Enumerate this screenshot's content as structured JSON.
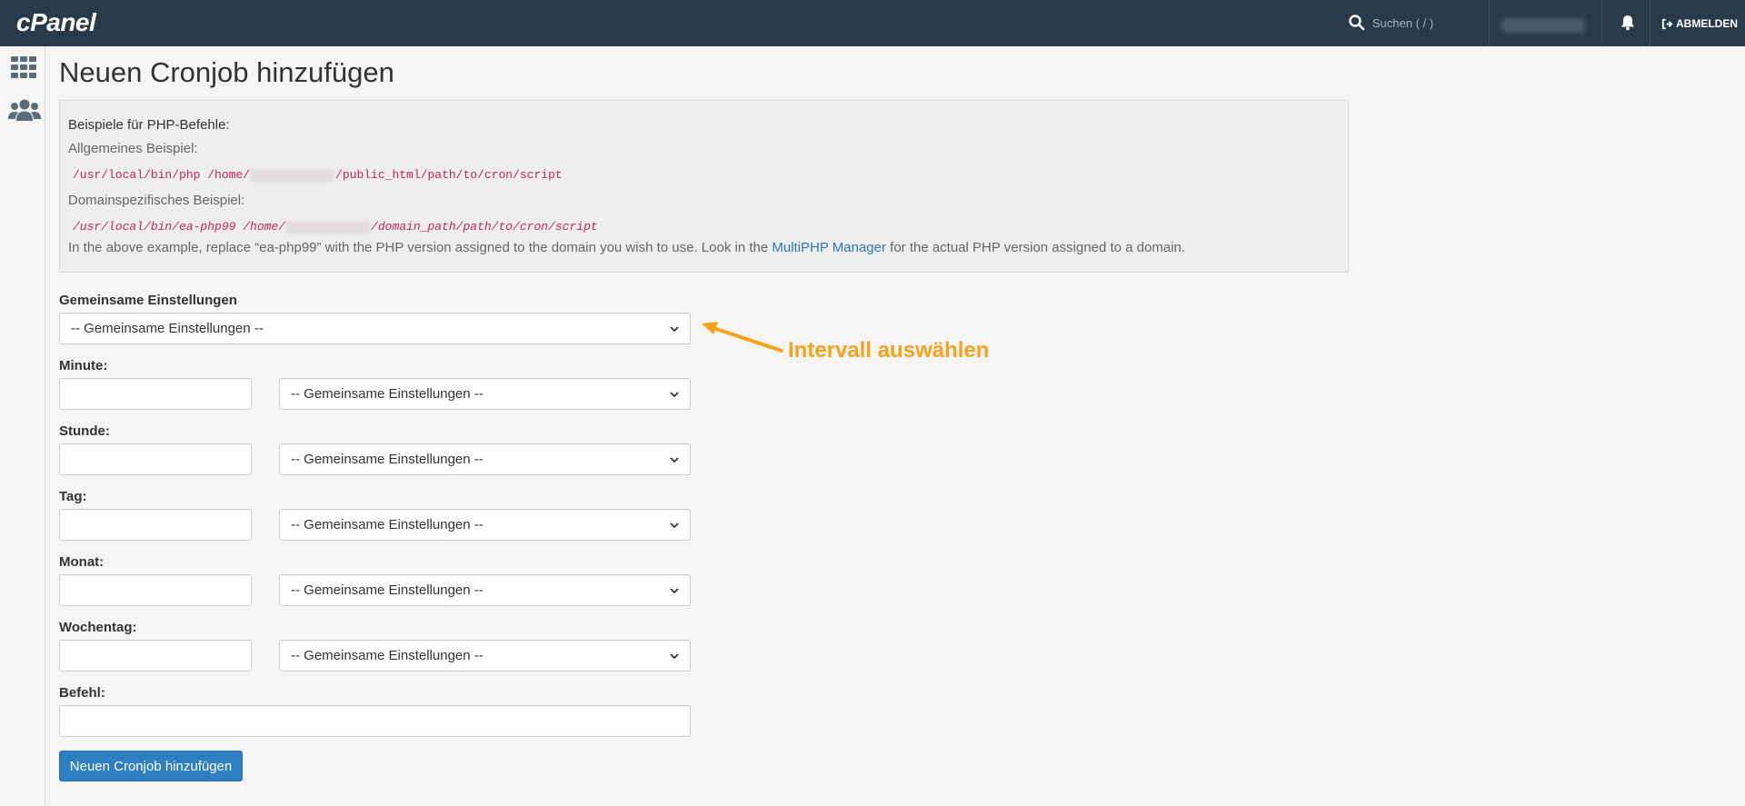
{
  "app": {
    "logo": "cPanel"
  },
  "topbar": {
    "search_placeholder": "Suchen ( / )",
    "logout_label": "ABMELDEN"
  },
  "page": {
    "title": "Neuen Cronjob hinzufügen"
  },
  "examples": {
    "heading": "Beispiele für PHP-Befehle:",
    "general_label": "Allgemeines Beispiel:",
    "general_code_prefix": "/usr/local/bin/php /home/",
    "general_code_suffix": "/public_html/path/to/cron/script",
    "domain_label": "Domainspezifisches Beispiel:",
    "domain_code_prefix": "/usr/local/bin/ea-php99 /home/",
    "domain_code_suffix": "/domain_path/path/to/cron/script",
    "note_before": "In the above example, replace “ea-php99” with the PHP version assigned to the domain you wish to use. Look in the ",
    "note_link": "MultiPHP Manager",
    "note_after": " for the actual PHP version assigned to a domain."
  },
  "form": {
    "common_label": "Gemeinsame Einstellungen",
    "common_select_value": "-- Gemeinsame Einstellungen --",
    "minute_label": "Minute:",
    "hour_label": "Stunde:",
    "day_label": "Tag:",
    "month_label": "Monat:",
    "weekday_label": "Wochentag:",
    "field_select_value": "-- Gemeinsame Einstellungen --",
    "command_label": "Befehl:",
    "submit_label": "Neuen Cronjob hinzufügen"
  },
  "annotation": {
    "text": "Intervall auswählen",
    "color": "#f7a21b"
  },
  "colors": {
    "topbar": "#293a4a",
    "link": "#2a7ab9",
    "code": "#c7254e",
    "primary_button": "#2e7ec2"
  },
  "icons": [
    "search-icon",
    "bell-icon",
    "sign-out-icon",
    "grid-icon",
    "users-icon",
    "chevron-down-icon"
  ]
}
